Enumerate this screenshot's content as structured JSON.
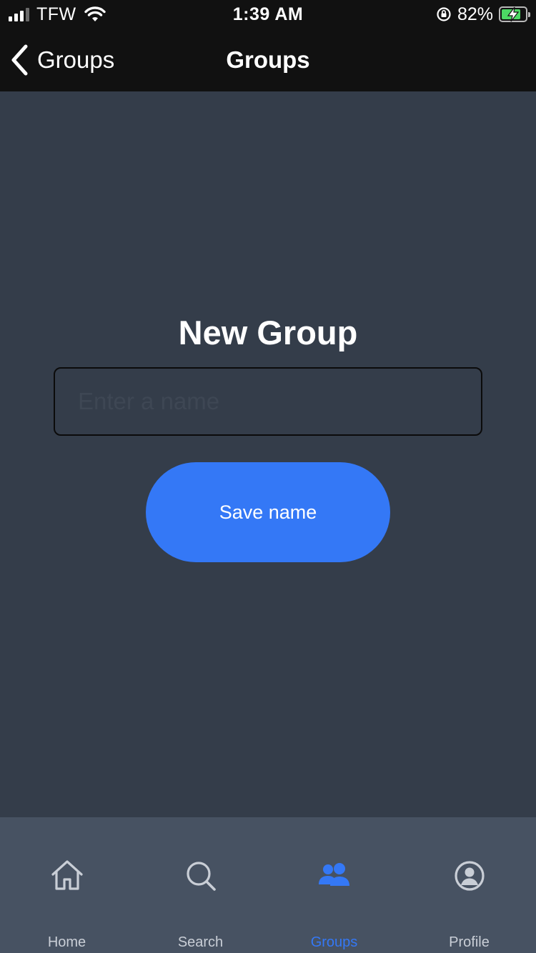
{
  "status_bar": {
    "carrier": "TFW",
    "time": "1:39 AM",
    "battery_percent": "82%",
    "battery_level": 0.82
  },
  "nav": {
    "back_label": "Groups",
    "title": "Groups"
  },
  "main": {
    "title": "New Group",
    "input_value": "",
    "input_placeholder": "Enter a name",
    "save_label": "Save name"
  },
  "tabs": [
    {
      "label": "Home",
      "icon": "home-icon",
      "active": false
    },
    {
      "label": "Search",
      "icon": "search-icon",
      "active": false
    },
    {
      "label": "Groups",
      "icon": "groups-icon",
      "active": true
    },
    {
      "label": "Profile",
      "icon": "profile-icon",
      "active": false
    }
  ],
  "colors": {
    "background": "#343d4a",
    "bars": "#111111",
    "accent": "#3478f6",
    "tab_bar": "#475262"
  }
}
